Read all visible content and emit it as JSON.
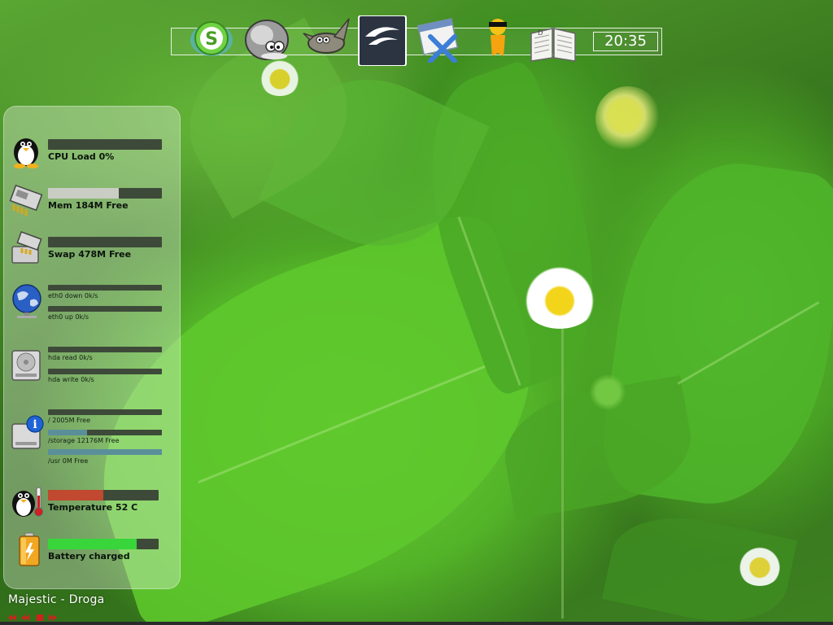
{
  "dock": {
    "items": [
      {
        "name": "Skype",
        "icon": "skype-icon"
      },
      {
        "name": "Mouse",
        "icon": "mouse-icon"
      },
      {
        "name": "GIMP",
        "icon": "gimp-icon"
      },
      {
        "name": "OpenOffice.org",
        "icon": "openoffice-icon"
      },
      {
        "name": "Calendar",
        "icon": "calendar-icon"
      },
      {
        "name": "Messenger",
        "icon": "messenger-icon"
      },
      {
        "name": "Dictionary",
        "icon": "dictionary-icon"
      }
    ],
    "clock": "20:35"
  },
  "monitor": {
    "cpu": {
      "label": "CPU Load 0%",
      "level": 0.0
    },
    "mem": {
      "label": "Mem 184M Free",
      "level": 0.62
    },
    "swap": {
      "label": "Swap 478M Free",
      "level": 0.0
    },
    "net": {
      "down_label": "eth0 down 0k/s",
      "up_label": "eth0 up 0k/s",
      "down_level": 0.0,
      "up_level": 0.0
    },
    "disk": {
      "read_label": "hda read 0k/s",
      "write_label": "hda write 0k/s",
      "read_level": 0.0,
      "write_level": 0.0
    },
    "fs": [
      {
        "label": "/ 2005M Free",
        "level": 0.0
      },
      {
        "label": "/storage 12176M Free",
        "level": 0.34
      },
      {
        "label": "/usr 0M Free",
        "level": 1.0
      }
    ],
    "temp": {
      "label": "Temperature 52 C",
      "level": 0.5
    },
    "battery": {
      "label": "Battery  charged",
      "level": 0.8
    }
  },
  "player": {
    "now_playing": "Majestic - Droga",
    "controls": [
      "previous",
      "stop",
      "next"
    ]
  },
  "colors": {
    "bar_bg": "#3e4a39",
    "mem_fill": "#c9cdc3",
    "fs_fill": "#5a8f9a",
    "temp_fill": "#c0492f",
    "battery_fill": "#38d63a",
    "player_controls": "#d21f1f"
  }
}
